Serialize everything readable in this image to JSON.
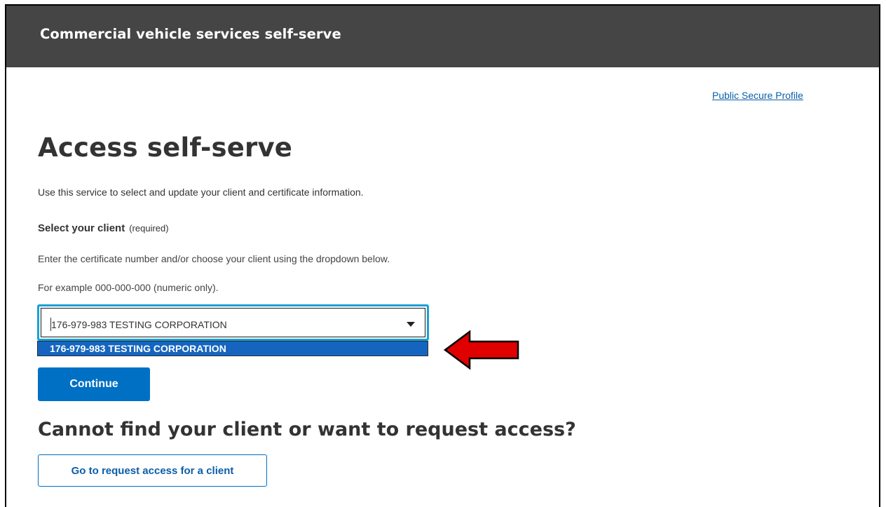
{
  "header": {
    "title": "Commercial vehicle services self-serve"
  },
  "nav": {
    "profile_link": "Public Secure Profile"
  },
  "main": {
    "title": "Access self-serve",
    "intro": "Use this service to select and update your client and certificate information.",
    "select": {
      "label": "Select your client",
      "required": "(required)",
      "help1": "Enter the certificate number and/or choose your client using the dropdown below.",
      "help2": "For example 000-000-000 (numeric only).",
      "value": "176-979-983 TESTING CORPORATION",
      "options": [
        "176-979-983 TESTING CORPORATION"
      ]
    },
    "continue_label": "Continue",
    "request_heading": "Cannot find your client or want to request access?",
    "request_button": "Go to request access for a client"
  },
  "annotation": {
    "arrow_color": "#e00000",
    "arrow_icon": "left-arrow-icon"
  },
  "colors": {
    "header_bg": "#454545",
    "primary": "#0070c4",
    "focus": "#1aa1d6",
    "highlight": "#1565c0"
  }
}
